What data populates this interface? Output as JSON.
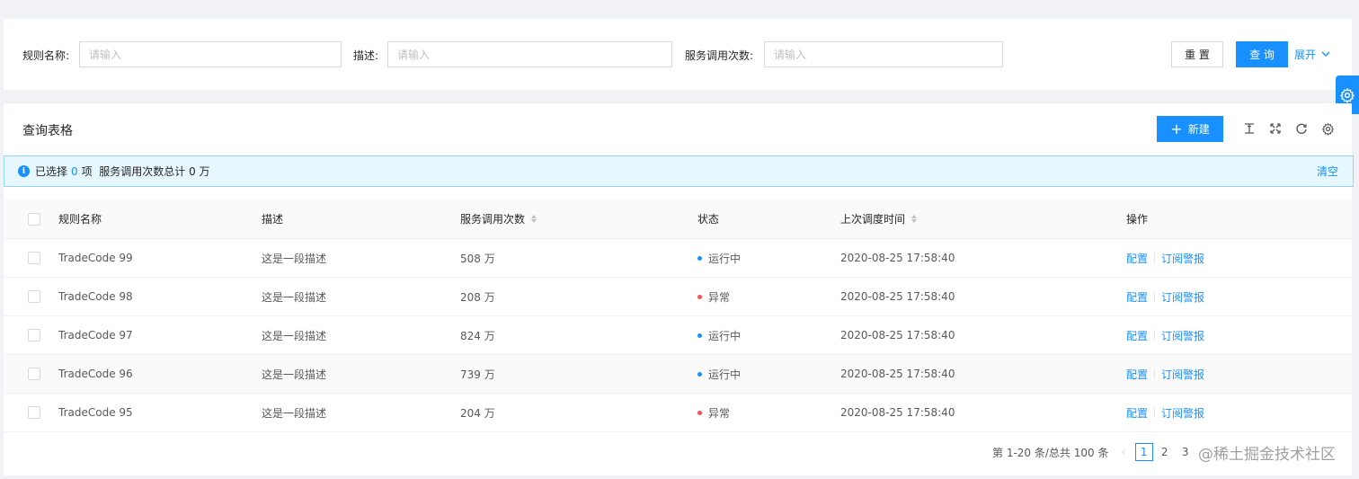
{
  "search": {
    "fields": [
      {
        "label": "规则名称:",
        "placeholder": "请输入"
      },
      {
        "label": "描述:",
        "placeholder": "请输入"
      },
      {
        "label": "服务调用次数:",
        "placeholder": "请输入"
      }
    ],
    "reset_label": "重 置",
    "query_label": "查 询",
    "expand_label": "展开"
  },
  "table_card": {
    "title": "查询表格",
    "new_label": "新建"
  },
  "alert": {
    "prefix": "已选择",
    "count": "0",
    "suffix": "项  服务调用次数总计 0 万",
    "clear_label": "清空"
  },
  "columns": [
    "规则名称",
    "描述",
    "服务调用次数",
    "状态",
    "上次调度时间",
    "操作"
  ],
  "rows": [
    {
      "name": "TradeCode 99",
      "desc": "这是一段描述",
      "calls": "508 万",
      "status": "运行中",
      "time": "2020-08-25 17:58:40"
    },
    {
      "name": "TradeCode 98",
      "desc": "这是一段描述",
      "calls": "208 万",
      "status": "异常",
      "time": "2020-08-25 17:58:40"
    },
    {
      "name": "TradeCode 97",
      "desc": "这是一段描述",
      "calls": "824 万",
      "status": "运行中",
      "time": "2020-08-25 17:58:40"
    },
    {
      "name": "TradeCode 96",
      "desc": "这是一段描述",
      "calls": "739 万",
      "status": "运行中",
      "time": "2020-08-25 17:58:40"
    },
    {
      "name": "TradeCode 95",
      "desc": "这是一段描述",
      "calls": "204 万",
      "status": "异常",
      "time": "2020-08-25 17:58:40"
    }
  ],
  "actions": {
    "config": "配置",
    "subscribe": "订阅警报"
  },
  "status_colors": {
    "running": "#1890ff",
    "error": "#ff4d4f"
  },
  "pagination": {
    "total_text": "第 1-20 条/总共 100 条",
    "pages": [
      "1",
      "2",
      "3"
    ],
    "current": "1"
  },
  "watermark": "@稀土掘金技术社区"
}
